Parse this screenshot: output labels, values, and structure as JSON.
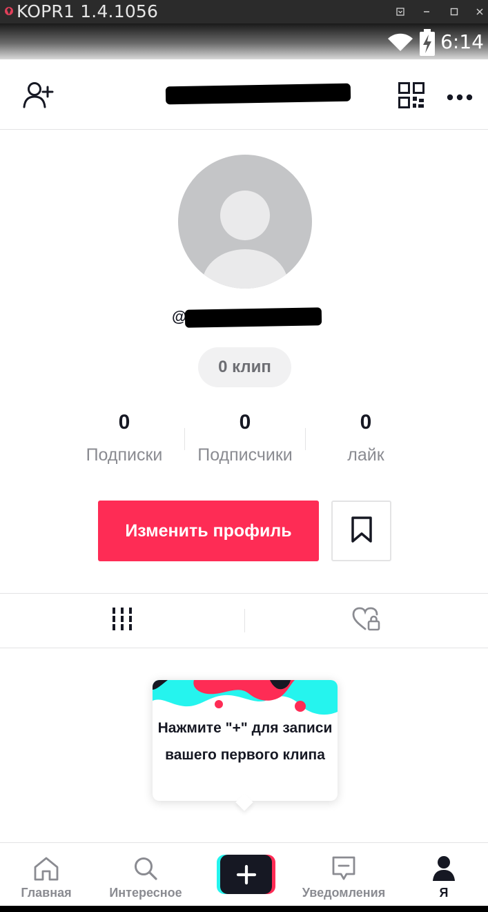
{
  "window": {
    "title": "KOPR1 1.4.1056"
  },
  "status_bar": {
    "time": "6:14",
    "icons": [
      "wifi-icon",
      "battery-charging-icon"
    ]
  },
  "top_bar": {
    "username": "",
    "icons": [
      "add-user-icon",
      "qr-code-icon",
      "more-icon"
    ]
  },
  "profile": {
    "handle_prefix": "@",
    "handle": "",
    "clips_badge": "0 клип"
  },
  "stats": [
    {
      "value": "0",
      "label": "Подписки"
    },
    {
      "value": "0",
      "label": "Подписчики"
    },
    {
      "value": "0",
      "label": "лайк"
    }
  ],
  "actions": {
    "edit_profile": "Изменить профиль",
    "bookmark_icon": "bookmark-icon"
  },
  "tabs": {
    "videos_icon": "grid-icon",
    "liked_icon": "heart-lock-icon"
  },
  "tooltip": {
    "line1": "Нажмите \"+\" для записи",
    "line2": "вашего первого клипа"
  },
  "bottom_nav": {
    "items": [
      {
        "label": "Главная",
        "icon": "home-icon"
      },
      {
        "label": "Интересное",
        "icon": "search-icon"
      },
      {
        "label": "",
        "icon": "plus-icon"
      },
      {
        "label": "Уведомления",
        "icon": "inbox-icon"
      },
      {
        "label": "Я",
        "icon": "profile-icon"
      }
    ]
  },
  "colors": {
    "accent": "#fe2c55",
    "teal": "#25f4ee",
    "text": "#161823",
    "muted": "#8a8b91"
  }
}
